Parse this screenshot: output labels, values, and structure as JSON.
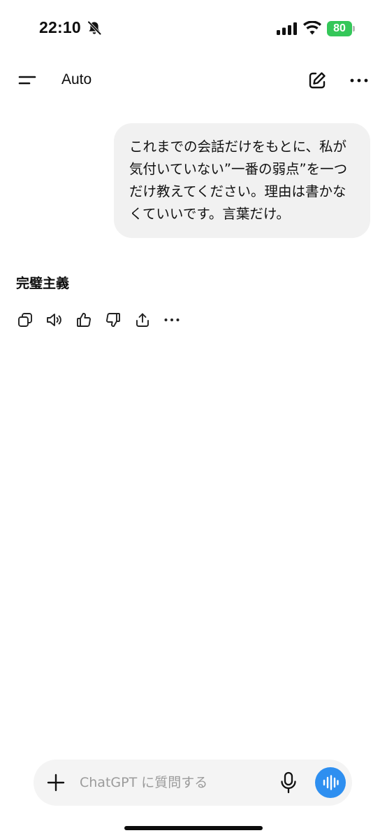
{
  "status_bar": {
    "time": "22:10",
    "battery": "80",
    "icons": [
      "bell-muted-icon",
      "signal-icon",
      "wifi-icon",
      "battery-icon"
    ]
  },
  "header": {
    "model": "Auto",
    "icons": [
      "menu-icon",
      "new-chat-icon",
      "more-icon"
    ]
  },
  "conversation": {
    "user_message": "これまでの会話だけをもとに、私が気付いていない”一番の弱点”を一つだけ教えてください。理由は書かなくていいです。言葉だけ。",
    "assistant_message": "完璧主義",
    "actions": [
      "copy-icon",
      "read-aloud-icon",
      "thumbs-up-icon",
      "thumbs-down-icon",
      "share-icon",
      "more-icon"
    ]
  },
  "composer": {
    "placeholder": "ChatGPT に質問する",
    "value": "",
    "icons": [
      "plus-icon",
      "mic-icon",
      "voice-mode-icon"
    ]
  },
  "colors": {
    "accent": "#2e8ff0",
    "battery": "#34c759",
    "bubble": "#f1f1f1",
    "composer": "#f4f4f4"
  }
}
